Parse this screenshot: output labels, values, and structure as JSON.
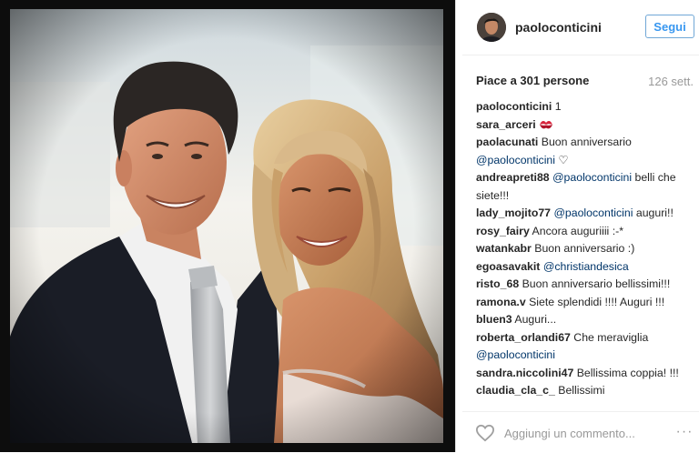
{
  "post": {
    "username": "paoloconticini",
    "follow_label": "Segui",
    "likes_text": "Piace a 301 persone",
    "age_text": "126 sett.",
    "comments": [
      {
        "user": "paoloconticini",
        "parts": [
          {
            "t": " 1"
          }
        ]
      },
      {
        "user": "sara_arceri",
        "parts": [
          {
            "t": " "
          }
        ],
        "emoji": "kiss-mark-icon"
      },
      {
        "user": "paolacunati",
        "parts": [
          {
            "t": " Buon anniversario "
          },
          {
            "m": "@paoloconticini"
          },
          {
            "t": " ♡"
          }
        ]
      },
      {
        "user": "andreapreti88",
        "parts": [
          {
            "t": " "
          },
          {
            "m": "@paoloconticini"
          },
          {
            "t": " belli che siete!!!"
          }
        ]
      },
      {
        "user": "lady_mojito77",
        "parts": [
          {
            "t": " "
          },
          {
            "m": "@paoloconticini"
          },
          {
            "t": " auguri!!"
          }
        ]
      },
      {
        "user": "rosy_fairy",
        "parts": [
          {
            "t": " Ancora auguriiii :-*"
          }
        ]
      },
      {
        "user": "watankabr",
        "parts": [
          {
            "t": " Buon anniversario :)"
          }
        ]
      },
      {
        "user": "egoasavakit",
        "parts": [
          {
            "t": " "
          },
          {
            "m": "@christiandesica"
          }
        ]
      },
      {
        "user": "risto_68",
        "parts": [
          {
            "t": " Buon anniversario bellissimi!!!"
          }
        ]
      },
      {
        "user": "ramona.v",
        "parts": [
          {
            "t": " Siete splendidi !!!! Auguri !!!"
          }
        ]
      },
      {
        "user": "bluen3",
        "parts": [
          {
            "t": " Auguri..."
          }
        ]
      },
      {
        "user": "roberta_orlandi67",
        "parts": [
          {
            "t": " Che meraviglia "
          },
          {
            "m": "@paoloconticini"
          }
        ]
      },
      {
        "user": "sandra.niccolini47",
        "parts": [
          {
            "t": " Bellissima coppia! !!!"
          }
        ]
      },
      {
        "user": "claudia_cla_c_",
        "parts": [
          {
            "t": " Bellissimi"
          }
        ]
      }
    ],
    "comment_placeholder": "Aggiungi un commento...",
    "more_label": "···"
  },
  "colors": {
    "follow_blue": "#3897f0",
    "mention_blue": "#003569",
    "text_dark": "#262626",
    "muted_gray": "#999999"
  }
}
